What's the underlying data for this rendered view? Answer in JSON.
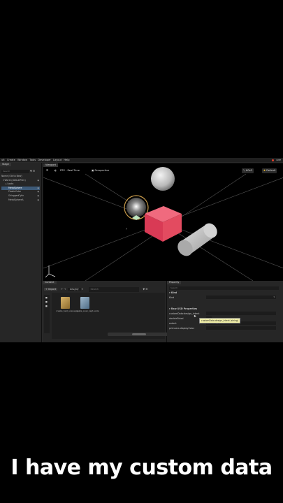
{
  "menubar": {
    "items": [
      "ult",
      "Create",
      "Window",
      "Tools",
      "Developer",
      "Layout",
      "Help"
    ],
    "live_label": "LIVE"
  },
  "stage": {
    "tab_label": "Stage",
    "search_placeholder": "Search",
    "tree": [
      {
        "label": "Name (Old to New)",
        "selected": false
      },
      {
        "label": "World (defaultPrim)",
        "selected": false
      },
      {
        "label": "Looks",
        "selected": false
      },
      {
        "label": "MetalSphere",
        "selected": true
      },
      {
        "label": "PlasticCube",
        "selected": false
      },
      {
        "label": "ShinggedCylin",
        "selected": false
      },
      {
        "label": "MetalSphereA",
        "selected": false
      }
    ]
  },
  "viewport": {
    "tab_label": "Viewport",
    "renderer_label": "RTX - Real-Time",
    "camera_label": "Perspective",
    "resolution_label": "60x2",
    "lighting_label": "Default"
  },
  "content": {
    "tab_label": "Content",
    "import_label": "Import",
    "path_label": "dev/ply",
    "search_placeholder": "Search",
    "files": [
      {
        "name": "create_test_scene.py",
        "type": "py"
      },
      {
        "name": "create_scen_legt.usda",
        "type": "usd"
      }
    ]
  },
  "property": {
    "tab_label": "Property",
    "search_placeholder": "Search",
    "kind_section": "Kind",
    "kind_label": "Kind",
    "raw_section": "Raw USD Properties",
    "rows": [
      {
        "label": "customData:design_intent",
        "value": ""
      },
      {
        "label": "doubleSided",
        "value": ""
      },
      {
        "label": "extent",
        "value": "(-1,-1,-1) (1,1,1)"
      },
      {
        "label": "primvars:displayColor",
        "value": ""
      }
    ],
    "tooltip": "customData:design_intent (string)"
  },
  "caption": "I have my custom data",
  "colors": {
    "accent": "#3d5a78",
    "cube": "#e34b60",
    "tooltip": "#f2f0a8"
  }
}
